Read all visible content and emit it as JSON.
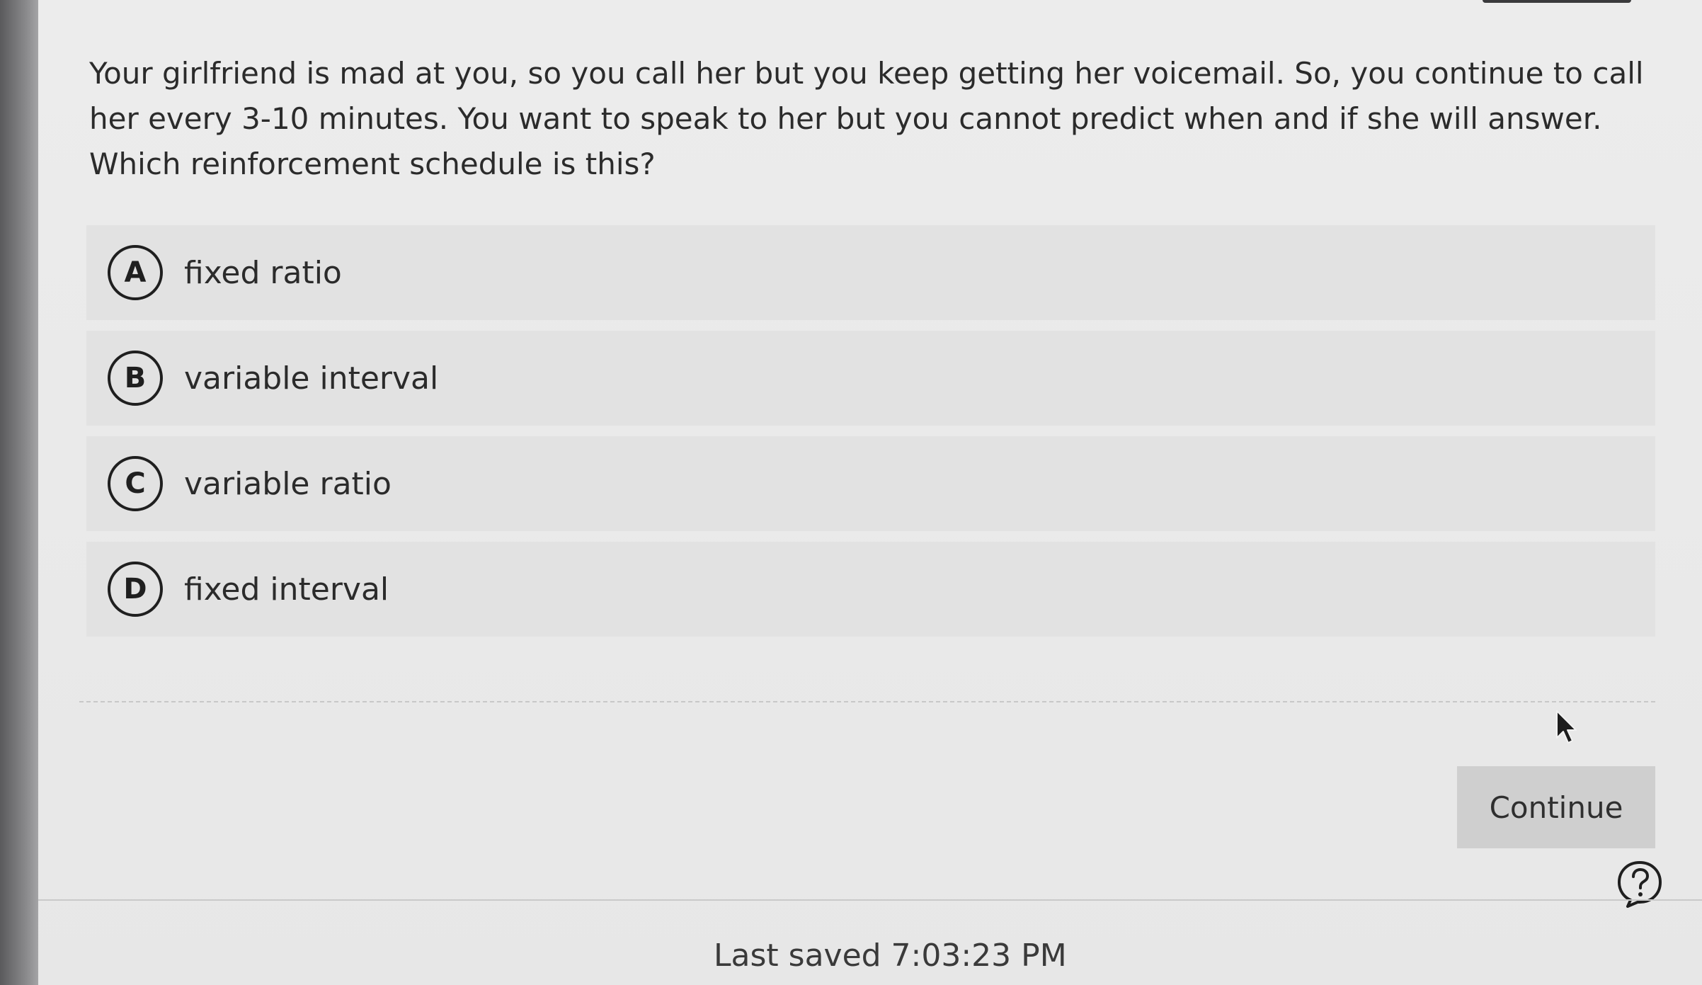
{
  "question": {
    "text": "Your girlfriend is mad at you, so you call her but you keep getting her voicemail. So, you continue to call her every 3-10 minutes. You want to speak to her but you cannot predict when and if she will answer. Which reinforcement schedule is this?"
  },
  "options": [
    {
      "letter": "A",
      "label": "fixed ratio"
    },
    {
      "letter": "B",
      "label": "variable interval"
    },
    {
      "letter": "C",
      "label": "variable ratio"
    },
    {
      "letter": "D",
      "label": "fixed interval"
    }
  ],
  "actions": {
    "continue_label": "Continue"
  },
  "footer": {
    "last_saved": "Last saved 7:03:23 PM"
  },
  "icons": {
    "help": "question-mark-circle-icon",
    "cursor": "mouse-pointer-icon"
  },
  "colors": {
    "option_background": "#e2e2e2",
    "button_background": "#cfcfcf",
    "text": "#2b2b2b"
  }
}
